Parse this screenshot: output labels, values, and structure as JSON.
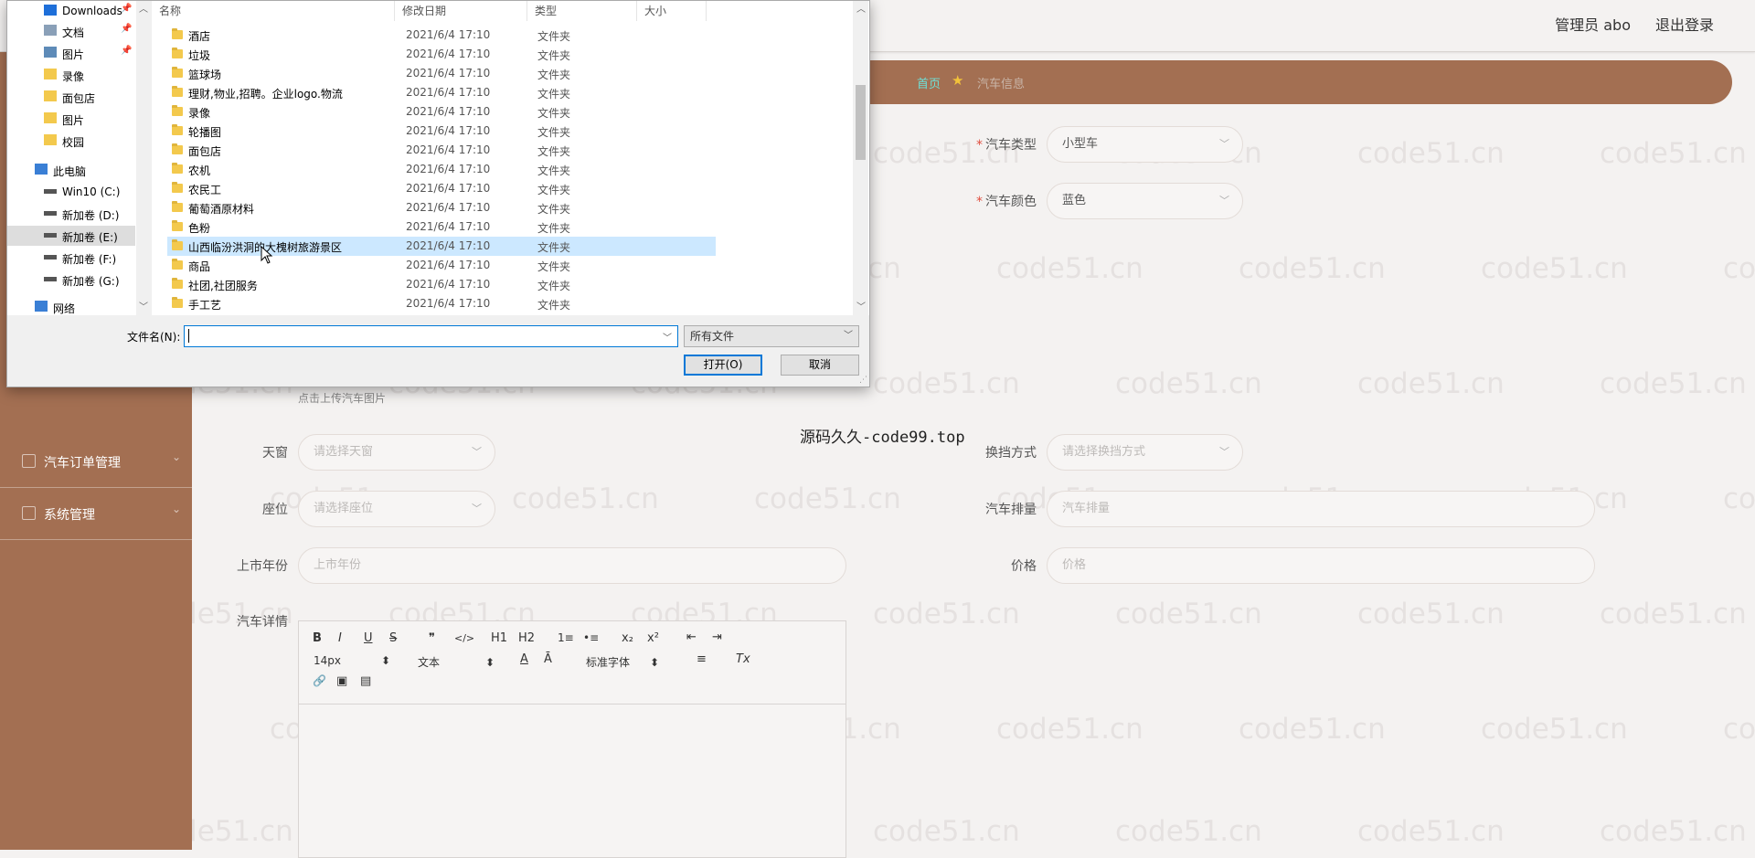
{
  "header": {
    "user": "管理员 abo",
    "logout": "退出登录"
  },
  "sidebar": {
    "items": [
      {
        "label": "汽车订单管理",
        "icon": "order-icon"
      },
      {
        "label": "系统管理",
        "icon": "settings-icon"
      }
    ]
  },
  "breadcrumb": {
    "home": "首页",
    "current": "汽车信息",
    "icon": "star-icon"
  },
  "form": {
    "type": {
      "label": "汽车类型",
      "value": "小型车"
    },
    "color": {
      "label": "汽车颜色",
      "value": "蓝色"
    },
    "upload_hint": "点击上传汽车图片",
    "sunroof": {
      "label": "天窗",
      "placeholder": "请选择天窗"
    },
    "gearbox": {
      "label": "换挡方式",
      "placeholder": "请选择换挡方式"
    },
    "seats": {
      "label": "座位",
      "placeholder": "请选择座位"
    },
    "displacement": {
      "label": "汽车排量",
      "placeholder": "汽车排量"
    },
    "year": {
      "label": "上市年份",
      "placeholder": "上市年份"
    },
    "price": {
      "label": "价格",
      "placeholder": "价格"
    },
    "detail": {
      "label": "汽车详情"
    }
  },
  "editor": {
    "font_size": "14px",
    "text_style": "文本",
    "font_family": "标准字体",
    "buttons": [
      "B",
      "I",
      "U",
      "S",
      "❞",
      "</>",
      "H1",
      "H2",
      "1≡",
      "•≡",
      "x₂",
      "x²",
      "⇤",
      "⇥",
      "A",
      "Ā",
      "≡",
      "Tx",
      "🔗",
      "▣",
      "▤"
    ]
  },
  "overlay_text": "源码久久-code99.top",
  "watermark": "code51.cn",
  "dialog": {
    "nav": [
      {
        "label": "Downloads",
        "icon": "download-icon",
        "pinned": true
      },
      {
        "label": "文档",
        "icon": "document-icon",
        "pinned": true
      },
      {
        "label": "图片",
        "icon": "picture-icon",
        "pinned": true
      },
      {
        "label": "录像",
        "icon": "folder-icon",
        "pinned": false
      },
      {
        "label": "面包店",
        "icon": "folder-icon",
        "pinned": false
      },
      {
        "label": "图片",
        "icon": "folder-icon",
        "pinned": false
      },
      {
        "label": "校园",
        "icon": "folder-icon",
        "pinned": false
      },
      {
        "label": "此电脑",
        "icon": "computer-icon",
        "pinned": false
      },
      {
        "label": "Win10 (C:)",
        "icon": "drive-icon",
        "pinned": false
      },
      {
        "label": "新加卷 (D:)",
        "icon": "drive-icon",
        "pinned": false
      },
      {
        "label": "新加卷 (E:)",
        "icon": "drive-icon",
        "pinned": false,
        "selected": true
      },
      {
        "label": "新加卷 (F:)",
        "icon": "drive-icon",
        "pinned": false
      },
      {
        "label": "新加卷 (G:)",
        "icon": "drive-icon",
        "pinned": false
      },
      {
        "label": "网络",
        "icon": "network-icon",
        "pinned": false
      }
    ],
    "columns": {
      "name": "名称",
      "date": "修改日期",
      "type": "类型",
      "size": "大小"
    },
    "files": [
      {
        "name": "酒店",
        "date": "2021/6/4 17:10",
        "type": "文件夹"
      },
      {
        "name": "垃圾",
        "date": "2021/6/4 17:10",
        "type": "文件夹"
      },
      {
        "name": "篮球场",
        "date": "2021/6/4 17:10",
        "type": "文件夹"
      },
      {
        "name": "理财,物业,招聘。企业logo.物流",
        "date": "2021/6/4 17:10",
        "type": "文件夹"
      },
      {
        "name": "录像",
        "date": "2021/6/4 17:10",
        "type": "文件夹"
      },
      {
        "name": "轮播图",
        "date": "2021/6/4 17:10",
        "type": "文件夹"
      },
      {
        "name": "面包店",
        "date": "2021/6/4 17:10",
        "type": "文件夹"
      },
      {
        "name": "农机",
        "date": "2021/6/4 17:10",
        "type": "文件夹"
      },
      {
        "name": "农民工",
        "date": "2021/6/4 17:10",
        "type": "文件夹"
      },
      {
        "name": "葡萄酒原材料",
        "date": "2021/6/4 17:10",
        "type": "文件夹"
      },
      {
        "name": "色粉",
        "date": "2021/6/4 17:10",
        "type": "文件夹"
      },
      {
        "name": "山西临汾洪洞的大槐树旅游景区",
        "date": "2021/6/4 17:10",
        "type": "文件夹",
        "selected": true
      },
      {
        "name": "商品",
        "date": "2021/6/4 17:10",
        "type": "文件夹"
      },
      {
        "name": "社团,社团服务",
        "date": "2021/6/4 17:10",
        "type": "文件夹"
      },
      {
        "name": "手工艺",
        "date": "2021/6/4 17:10",
        "type": "文件夹"
      }
    ],
    "filename_label": "文件名(N):",
    "filename_value": "",
    "filetype": "所有文件",
    "open_button": "打开(O)",
    "cancel_button": "取消"
  }
}
